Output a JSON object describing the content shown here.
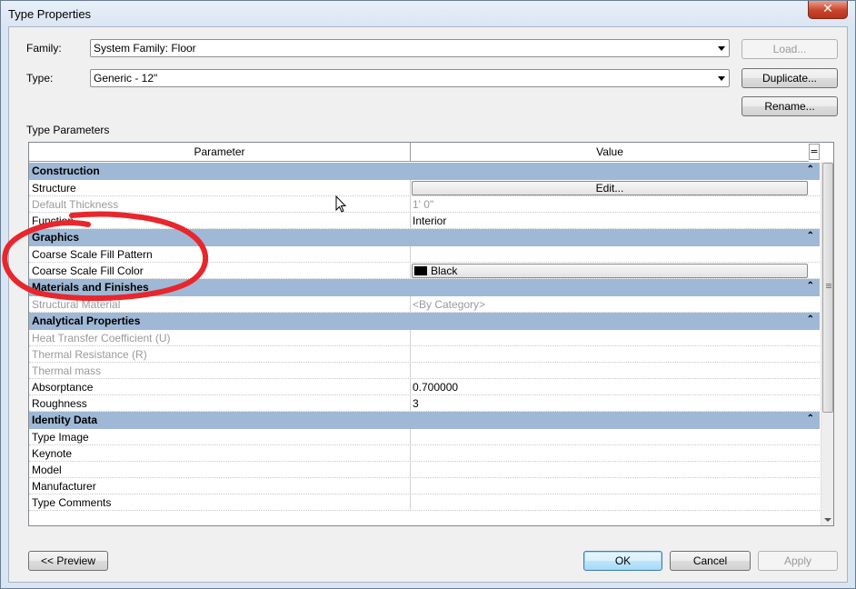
{
  "window": {
    "title": "Type Properties",
    "close_glyph": "✕"
  },
  "family": {
    "label": "Family:",
    "value": "System Family: Floor"
  },
  "type": {
    "label": "Type:",
    "value": "Generic - 12\""
  },
  "buttons": {
    "load": "Load...",
    "duplicate": "Duplicate...",
    "rename": "Rename...",
    "preview": "<< Preview",
    "ok": "OK",
    "cancel": "Cancel",
    "apply": "Apply"
  },
  "section_label": "Type Parameters",
  "grid": {
    "col_parameter": "Parameter",
    "col_value": "Value",
    "col_toggle": "=",
    "groups": [
      {
        "name": "Construction",
        "rows": [
          {
            "name": "Structure",
            "value": "Edit...",
            "dim": false,
            "button": true
          },
          {
            "name": "Default Thickness",
            "value": "1'  0\"",
            "dim": true
          },
          {
            "name": "Function",
            "value": "Interior",
            "dim": false
          }
        ]
      },
      {
        "name": "Graphics",
        "rows": [
          {
            "name": "Coarse Scale Fill Pattern",
            "value": "",
            "dim": false
          },
          {
            "name": "Coarse Scale Fill Color",
            "value": "Black",
            "dim": false,
            "swatch": true
          }
        ]
      },
      {
        "name": "Materials and Finishes",
        "rows": [
          {
            "name": "Structural Material",
            "value": "<By Category>",
            "dim": true
          }
        ]
      },
      {
        "name": "Analytical Properties",
        "rows": [
          {
            "name": "Heat Transfer Coefficient (U)",
            "value": "",
            "dim": true
          },
          {
            "name": "Thermal Resistance (R)",
            "value": "",
            "dim": true
          },
          {
            "name": "Thermal mass",
            "value": "",
            "dim": true
          },
          {
            "name": "Absorptance",
            "value": "0.700000",
            "dim": false
          },
          {
            "name": "Roughness",
            "value": "3",
            "dim": false
          }
        ]
      },
      {
        "name": "Identity Data",
        "rows": [
          {
            "name": "Type Image",
            "value": "",
            "dim": false
          },
          {
            "name": "Keynote",
            "value": "",
            "dim": false
          },
          {
            "name": "Model",
            "value": "",
            "dim": false
          },
          {
            "name": "Manufacturer",
            "value": "",
            "dim": false
          },
          {
            "name": "Type Comments",
            "value": "",
            "dim": false
          }
        ]
      }
    ],
    "collapse_glyph": "⌃"
  },
  "colors": {
    "group_header": "#9fb8d6",
    "annotation": "#e8262b",
    "dim_text": "#9a9a9a"
  }
}
